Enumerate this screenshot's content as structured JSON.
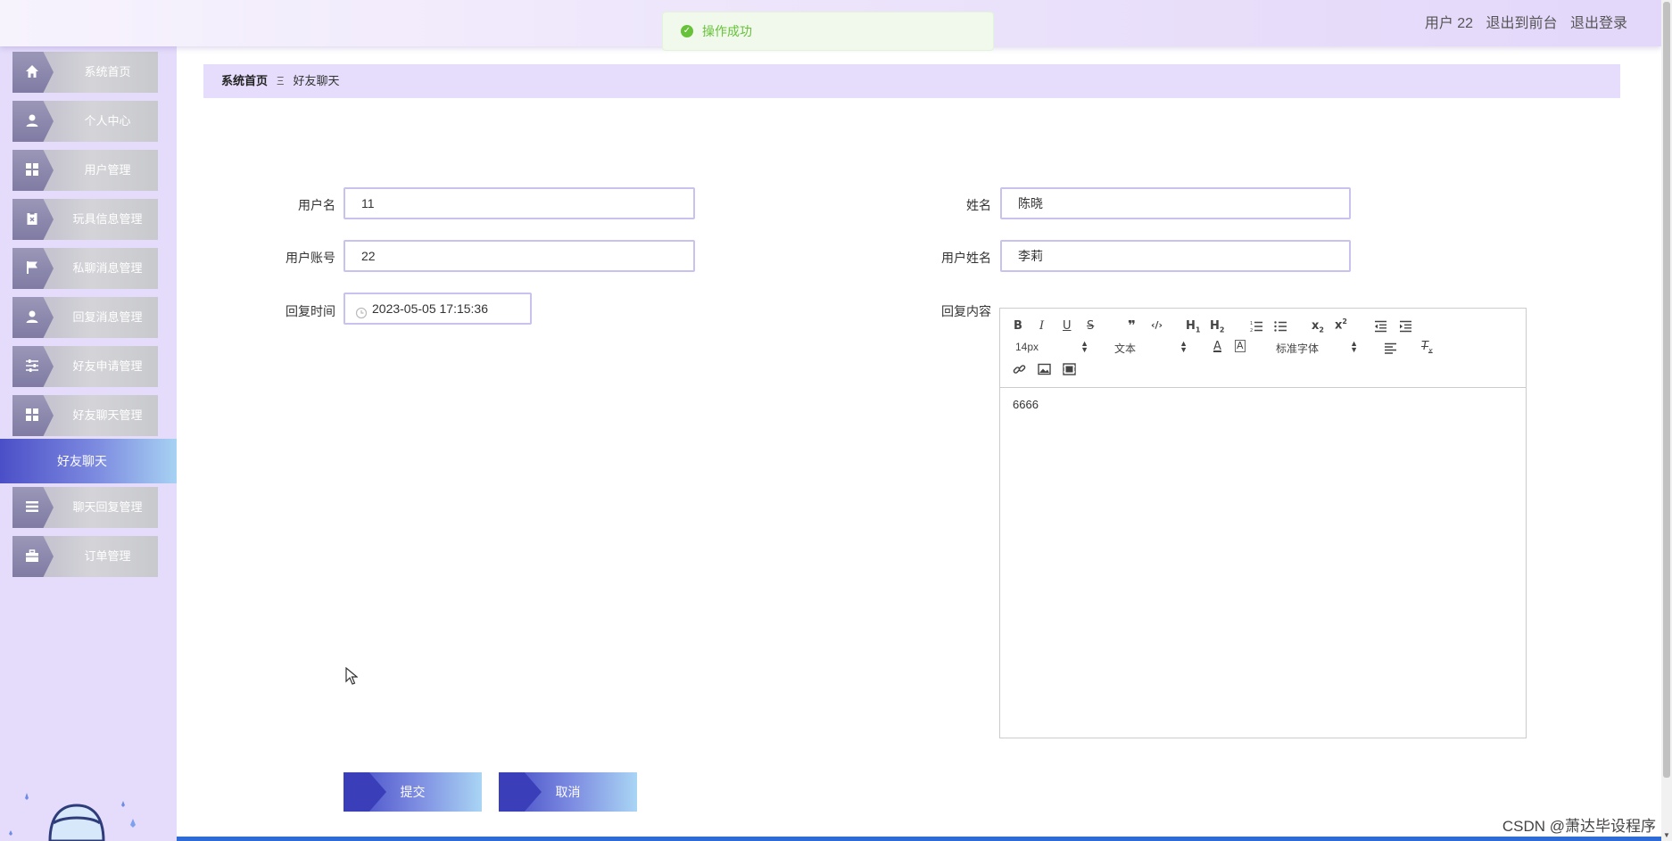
{
  "header": {
    "user_label": "用户 22",
    "back_to_front": "退出到前台",
    "logout": "退出登录"
  },
  "toast": {
    "message": "操作成功",
    "icon": "check-circle-icon",
    "color": "#67c23a"
  },
  "sidebar": {
    "items": [
      {
        "label": "系统首页",
        "icon": "home-icon"
      },
      {
        "label": "个人中心",
        "icon": "user-icon"
      },
      {
        "label": "用户管理",
        "icon": "grid-icon"
      },
      {
        "label": "玩具信息管理",
        "icon": "clipboard-icon"
      },
      {
        "label": "私聊消息管理",
        "icon": "flag-icon"
      },
      {
        "label": "回复消息管理",
        "icon": "user-icon"
      },
      {
        "label": "好友申请管理",
        "icon": "sliders-icon"
      },
      {
        "label": "好友聊天管理",
        "icon": "grid-icon"
      },
      {
        "label": "聊天回复管理",
        "icon": "list-icon"
      },
      {
        "label": "订单管理",
        "icon": "briefcase-icon"
      }
    ],
    "active": "好友聊天"
  },
  "breadcrumb": {
    "home": "系统首页",
    "separator": "Ξ",
    "current": "好友聊天"
  },
  "form": {
    "username_label": "用户名",
    "username": "11",
    "name_label": "姓名",
    "name": "陈晓",
    "account_label": "用户账号",
    "account": "22",
    "user_name_label": "用户姓名",
    "user_name": "李莉",
    "reply_time_label": "回复时间",
    "reply_time": "2023-05-05 17:15:36",
    "reply_content_label": "回复内容"
  },
  "editor": {
    "font_size": "14px",
    "paragraph": "文本",
    "font_family": "标准字体",
    "content": "6666"
  },
  "buttons": {
    "submit": "提交",
    "cancel": "取消"
  },
  "watermark": "CSDN @萧达毕设程序",
  "colors": {
    "accent": "#4b4fc7",
    "sidebar_bg": "#e4dcfa",
    "success": "#67c23a"
  }
}
